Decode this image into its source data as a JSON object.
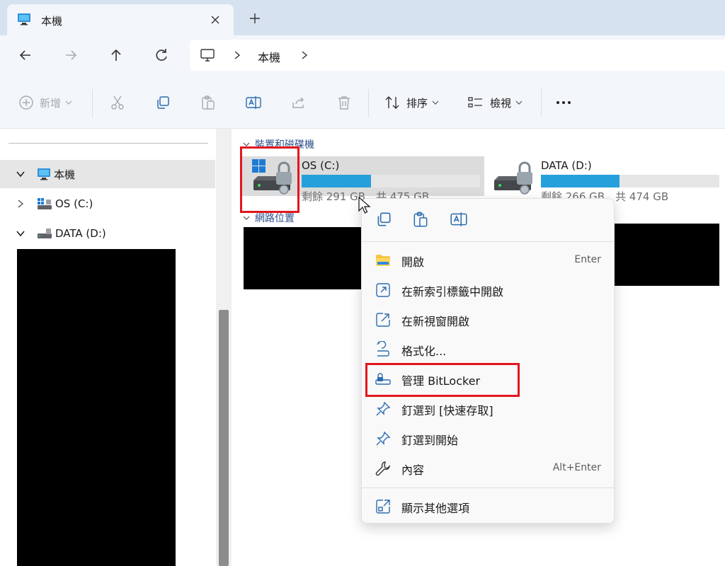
{
  "tab": {
    "title": "本機"
  },
  "address": {
    "crumb": "本機"
  },
  "toolbar": {
    "new_label": "新增",
    "sort_label": "排序",
    "view_label": "檢視"
  },
  "sidebar": {
    "items": [
      {
        "label": "本機"
      },
      {
        "label": "OS (C:)"
      },
      {
        "label": "DATA (D:)"
      }
    ]
  },
  "main": {
    "devices_header": "裝置和磁碟機",
    "network_header": "網路位置",
    "drives": [
      {
        "name": "OS (C:)",
        "free_text": "剩餘 291 GB，共 475 GB",
        "used_fraction": 0.39
      },
      {
        "name": "DATA (D:)",
        "free_text": "剩餘 266 GB，共 474 GB",
        "used_fraction": 0.44
      }
    ]
  },
  "context_menu": {
    "items": [
      {
        "label": "開啟",
        "shortcut": "Enter"
      },
      {
        "label": "在新索引標籤中開啟",
        "shortcut": ""
      },
      {
        "label": "在新視窗開啟",
        "shortcut": ""
      },
      {
        "label": "格式化...",
        "shortcut": ""
      },
      {
        "label": "管理 BitLocker",
        "shortcut": ""
      },
      {
        "label": "釘選到 [快速存取]",
        "shortcut": ""
      },
      {
        "label": "釘選到開始",
        "shortcut": ""
      },
      {
        "label": "內容",
        "shortcut": "Alt+Enter"
      },
      {
        "label": "顯示其他選項",
        "shortcut": ""
      }
    ]
  },
  "colors": {
    "accent": "#26a0da",
    "highlight": "#e3161d",
    "redaction": "#000000"
  }
}
